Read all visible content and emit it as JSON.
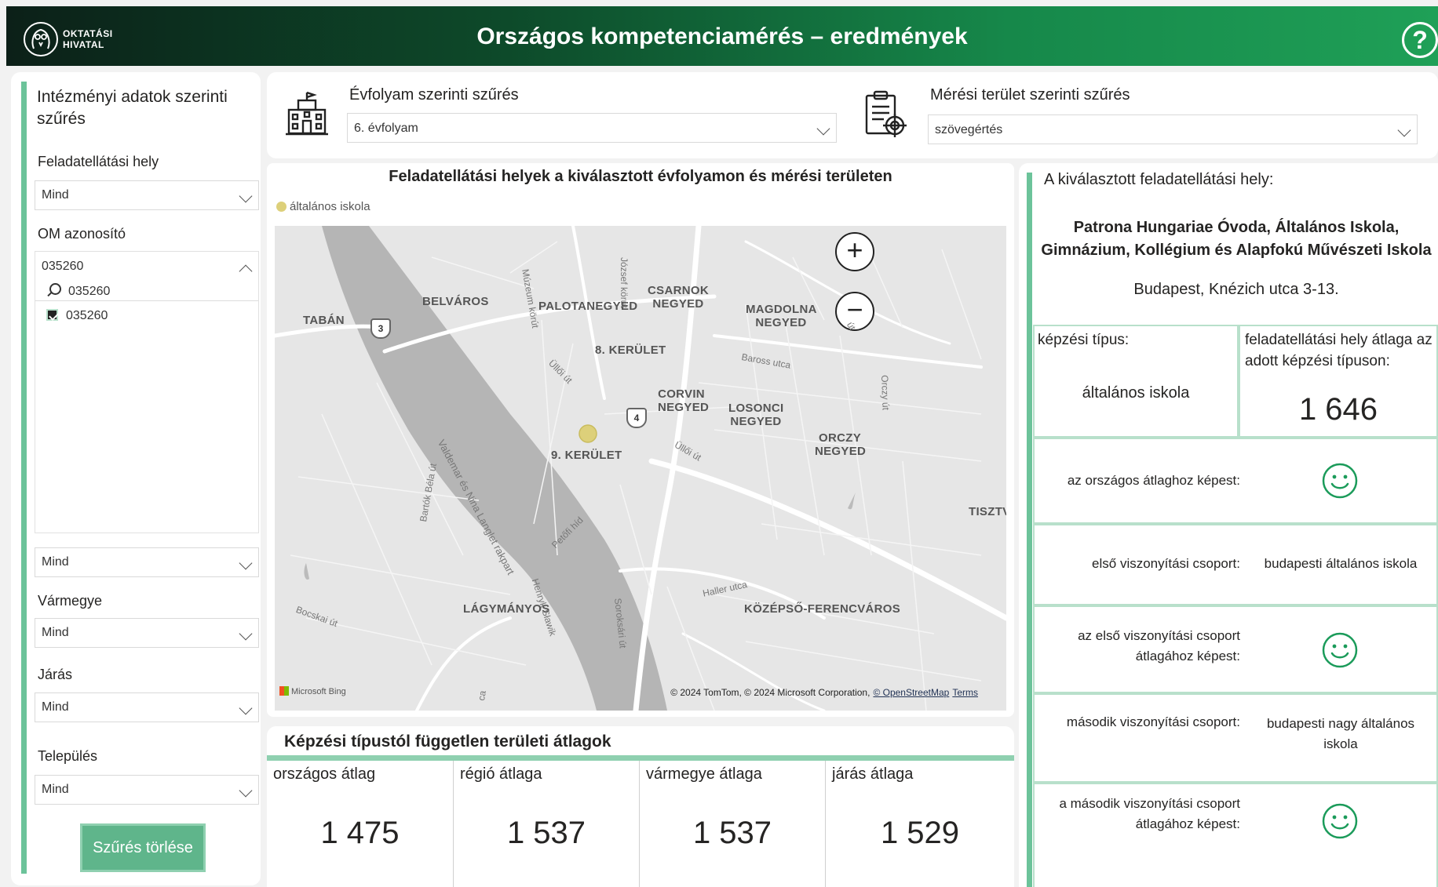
{
  "header": {
    "logo_text_line1": "OKTATÁSI",
    "logo_text_line2": "HIVATAL",
    "title": "Országos kompetenciamérés – eredmények",
    "help_icon": "question-icon",
    "help_glyph": "?"
  },
  "sidebar": {
    "title": "Intézményi adatok szerinti szűrés",
    "feladat_label": "Feladatellátási hely",
    "feladat_value": "Mind",
    "om_label": "OM azonosító",
    "om_value": "035260",
    "om_search_value": "035260",
    "om_option": "035260",
    "regio_value": "Mind",
    "varmegye_label": "Vármegye",
    "varmegye_value": "Mind",
    "jaras_label": "Járás",
    "jaras_value": "Mind",
    "telepules_label": "Település",
    "telepules_value": "Mind",
    "clear_button": "Szűrés törlése"
  },
  "filters": {
    "evfolyam_label": "Évfolyam szerinti szűrés",
    "evfolyam_value": "6. évfolyam",
    "meresi_label": "Mérési terület szerinti szűrés",
    "meresi_value": "szövegértés"
  },
  "map": {
    "title": "Feladatellátási helyek a kiválasztott évfolyamon és mérési területen",
    "legend": "általános iskola",
    "legend_color": "#ddd07a",
    "zoom_in": "+",
    "zoom_out": "−",
    "labels": {
      "taban": "TABÁN",
      "belvaros": "BELVÁROS",
      "palotanegyed": "PALOTANEGYED",
      "csarnok": "CSARNOK NEGYED",
      "magdolna": "MAGDOLNA NEGYED",
      "ker8": "8. KERÜLET",
      "corvin": "CORVIN NEGYED",
      "losonci": "LOSONCI NEGYED",
      "orczy": "ORCZY NEGYED",
      "ker9": "9. KERÜLET",
      "tisztv": "TISZTV",
      "lagymanyos": "LÁGYMÁNYOS",
      "kozepso": "KÖZÉPSŐ-FERENCVÁROS"
    },
    "streets": {
      "jozsef": "József körút",
      "muzeum": "Múzeum körút",
      "ulloi1": "Üllői út",
      "ulloi2": "Üllői út",
      "baross": "Baross utca",
      "orczy_ut": "Orczy út",
      "valdemar": "Valdemar és Nina Langlet rakpart",
      "bartok": "Bartók Béla út",
      "petofi": "Petőfi híd",
      "henryk": "Henryk Sławik",
      "soroksari": "Soroksári út",
      "haller": "Haller utca",
      "bocskai": "Bocskai út",
      "ca": "ca",
      "ut": "út"
    },
    "badges": {
      "b3": "3",
      "b4": "4"
    },
    "bing": "Microsoft Bing",
    "attribution": "© 2024 TomTom, © 2024 Microsoft Corporation,",
    "osm_link": "© OpenStreetMap",
    "terms_link": "Terms"
  },
  "averages": {
    "title": "Képzési típustól független területi átlagok",
    "items": [
      {
        "label": "országos átlag",
        "value": "1 475"
      },
      {
        "label": "régió átlaga",
        "value": "1 537"
      },
      {
        "label": "vármegye átlaga",
        "value": "1 537"
      },
      {
        "label": "járás átlaga",
        "value": "1 529"
      }
    ]
  },
  "detail": {
    "label": "A kiválasztott feladatellátási hely:",
    "name_line1": "Patrona Hungariae Óvoda, Általános Iskola,",
    "name_line2": "Gimnázium, Kollégium és Alapfokú Művészeti Iskola",
    "address": "Budapest, Knézich utca 3-13.",
    "kepzesi_tipus_label": "képzési típus:",
    "kepzesi_tipus_value": "általános iskola",
    "atlag_label": "feladatellátási hely átlaga az adott képzési típuson:",
    "atlag_value": "1 646",
    "orszagos_label": "az országos átlaghoz képest:",
    "elso_label": "első viszonyítási csoport:",
    "elso_value": "budapesti általános iskola",
    "elso_atlag_label_1": "az első viszonyítási csoport",
    "elso_atlag_label_2": "átlagához képest:",
    "masodik_label": "második viszonyítási csoport:",
    "masodik_value_1": "budapesti nagy általános",
    "masodik_value_2": "iskola",
    "masodik_atlag_label_1": "a második viszonyítási csoport",
    "masodik_atlag_label_2": "átlagához képest:",
    "smiley_color": "#1b9b5a",
    "smiley_icon": "smiley-icon"
  }
}
